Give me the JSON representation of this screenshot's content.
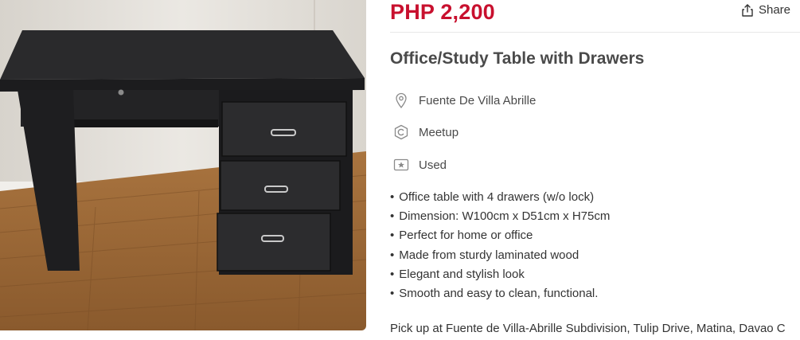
{
  "listing": {
    "price": "PHP 2,200",
    "share_label": "Share",
    "title": "Office/Study Table with Drawers",
    "location": "Fuente De Villa Abrille",
    "deal_method": "Meetup",
    "condition": "Used",
    "description_bullets": [
      "Office table with 4 drawers (w/o lock)",
      "Dimension: W100cm x D51cm x H75cm",
      "Perfect for home or office",
      "Made from sturdy laminated wood",
      "Elegant and stylish look",
      "Smooth and easy to clean, functional."
    ],
    "pickup_note": "Pick up at Fuente de Villa-Abrille Subdivision, Tulip Drive, Matina, Davao C",
    "icons": {
      "share": "share-icon",
      "location": "location-pin-icon",
      "deal_method": "meetup-icon",
      "condition": "condition-tag-icon"
    },
    "colors": {
      "price": "#c8102e",
      "text": "#4a4a4a"
    }
  }
}
